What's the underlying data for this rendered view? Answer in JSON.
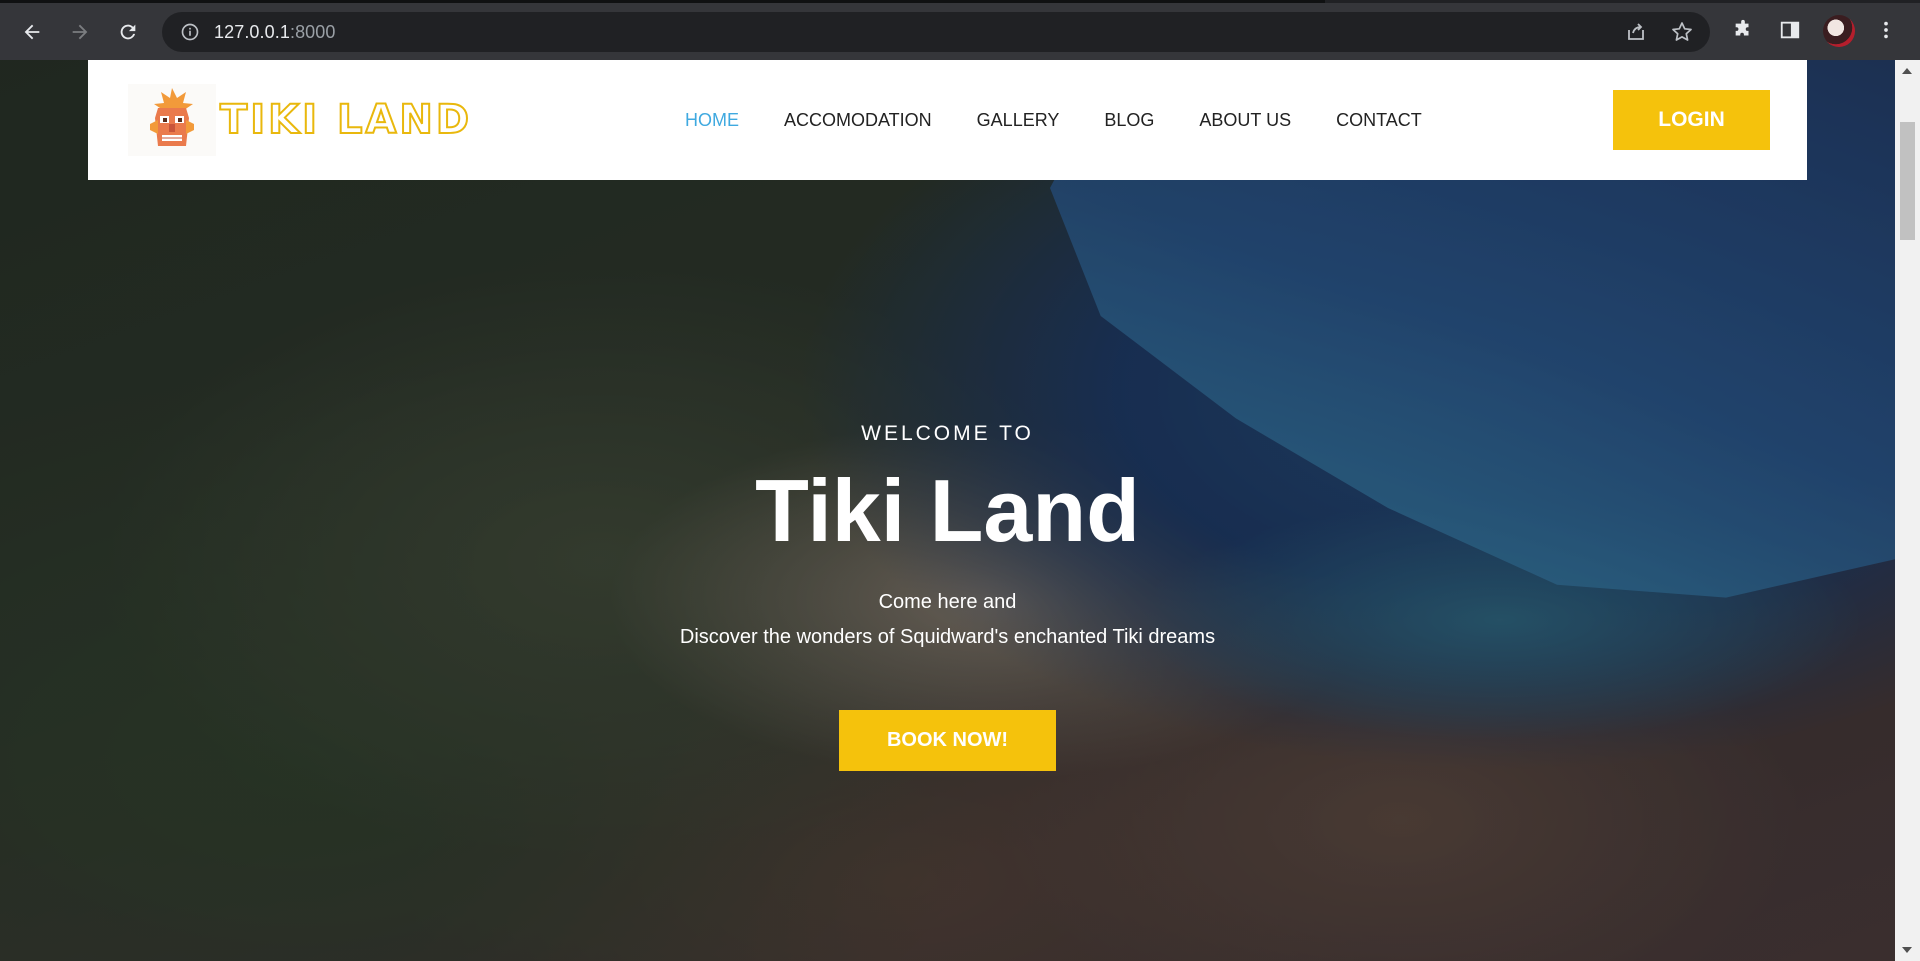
{
  "browser": {
    "url_host": "127.0.0.1",
    "url_port": ":8000",
    "icons": {
      "back": "back-arrow-icon",
      "forward": "forward-arrow-icon",
      "reload": "reload-icon",
      "info": "info-icon",
      "share": "share-icon",
      "bookmark": "star-icon",
      "extensions": "puzzle-icon",
      "side_panel": "side-panel-icon",
      "profile": "avatar",
      "menu": "kebab-menu-icon"
    }
  },
  "header": {
    "logo_text": "TIKI LAND",
    "nav": [
      {
        "label": "HOME",
        "active": true
      },
      {
        "label": "ACCOMODATION",
        "active": false
      },
      {
        "label": "GALLERY",
        "active": false
      },
      {
        "label": "BLOG",
        "active": false
      },
      {
        "label": "ABOUT US",
        "active": false
      },
      {
        "label": "CONTACT",
        "active": false
      }
    ],
    "login_label": "LOGIN"
  },
  "hero": {
    "eyebrow": "WELCOME TO",
    "title": "Tiki Land",
    "line1": "Come here and",
    "line2": "Discover the wonders of Squidward's enchanted Tiki dreams",
    "cta_label": "BOOK NOW!"
  },
  "colors": {
    "accent": "#f5c20c",
    "nav_active": "#3fa9e0",
    "chrome_bg": "#35363a",
    "omnibox_bg": "#202124"
  }
}
